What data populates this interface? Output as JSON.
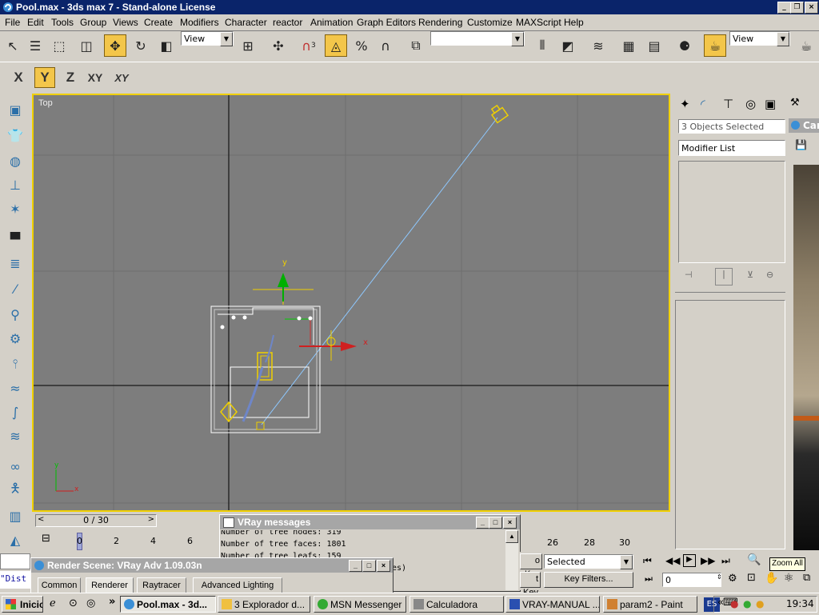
{
  "window": {
    "title": "Pool.max - 3ds max 7  - Stand-alone License"
  },
  "menu": [
    "File",
    "Edit",
    "Tools",
    "Group",
    "Views",
    "Create",
    "Modifiers",
    "Character",
    "reactor",
    "Animation",
    "Graph Editors",
    "Rendering",
    "Customize",
    "MAXScript",
    "Help"
  ],
  "toolbar": {
    "view_combo_1": "View",
    "view_combo_2": "View",
    "snap_number": "3"
  },
  "axes": [
    "X",
    "Y",
    "Z",
    "XY",
    "XY"
  ],
  "viewport": {
    "label": "Top",
    "gizmo_y": "y",
    "gizmo_x": "x",
    "corner_y": "y",
    "corner_x": "x"
  },
  "command_panel": {
    "selection": "3 Objects Selected",
    "modifier_list": "Modifier List"
  },
  "right_window": {
    "title_partial": "Car"
  },
  "timeline": {
    "frame": "0 / 30",
    "ticks": [
      "0",
      "2",
      "4",
      "6",
      "26",
      "28",
      "30"
    ]
  },
  "vray_messages": {
    "title": "VRay messages",
    "lines": [
      "Number of tree nodes: 319",
      "Number of tree faces: 1801",
      "Number of tree leafs: 159",
      "es)"
    ]
  },
  "render_scene": {
    "title": "Render Scene: VRay Adv 1.09.03n",
    "tabs": [
      "Common",
      "Renderer",
      "Raytracer",
      "Advanced Lighting"
    ]
  },
  "listener": {
    "text": "\"Dist"
  },
  "anim_controls": {
    "set_key_partial": "o Key",
    "key_partial": "t Key",
    "selected": "Selected",
    "key_filters": "Key Filters...",
    "frame_value": "0"
  },
  "tooltip": "Zoom All",
  "taskbar": {
    "start": "Inicio",
    "tasks": [
      "Pool.max - 3d...",
      "3 Explorador d...",
      "MSN Messenger",
      "Calculadora",
      "VRAY-MANUAL ...",
      "param2 - Paint"
    ],
    "lang": "ES",
    "clock": "19:34"
  },
  "colors": {
    "title_active": "#0a246a",
    "viewport_bg": "#7d7d7d",
    "viewport_border": "#f0d000",
    "highlight": "#f3c64a"
  }
}
